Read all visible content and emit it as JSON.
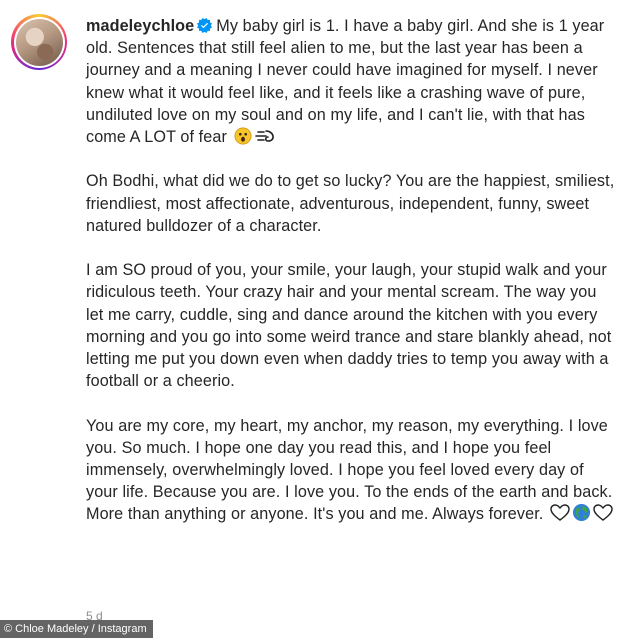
{
  "post": {
    "username": "madeleychloe",
    "verified": true,
    "paragraphs": [
      "My baby girl is 1. I have a baby girl. And she is 1 year old. Sentences that still feel alien to me, but the last year has been a journey and a meaning I never could have imagined for myself. I never knew what it would feel like, and it feels like a crashing wave of pure, undiluted love on my soul and on my life, and I can't lie, with that has come A LOT of fear",
      "Oh Bodhi, what did we do to get so lucky? You are the happiest, smiliest, friendliest, most affectionate, adventurous, independent, funny, sweet natured bulldozer of a character.",
      "I am SO proud of you, your smile, your laugh, your stupid walk and your ridiculous teeth. Your crazy hair and your mental scream. The way you let me carry, cuddle, sing and dance around the kitchen with you every morning and you go into some weird trance and stare blankly ahead, not letting me put you down even when daddy tries to temp you away with a football or a cheerio.",
      "You are my core, my heart, my anchor, my reason, my everything. I love you. So much. I hope one day you read this, and I hope you feel immensely, overwhelmingly loved. I hope you feel loved every day of your life. Because you are. I love you. To the ends of the earth and back. More than anything or anyone. It's you and me. Always forever."
    ],
    "timestamp": "5 d"
  },
  "icons": {
    "avatar": "profile-avatar",
    "verified": "verified-badge-icon",
    "fear_emoji": "astonished-face-emoji",
    "wind_emoji": "dashing-away-emoji",
    "heart_emoji": "white-heart-emoji",
    "globe_emoji": "globe-emoji"
  },
  "colors": {
    "text": "#262626",
    "verified_blue": "#0095f6",
    "muted": "#8e8e8e"
  },
  "credit": "© Chloe Madeley / Instagram"
}
